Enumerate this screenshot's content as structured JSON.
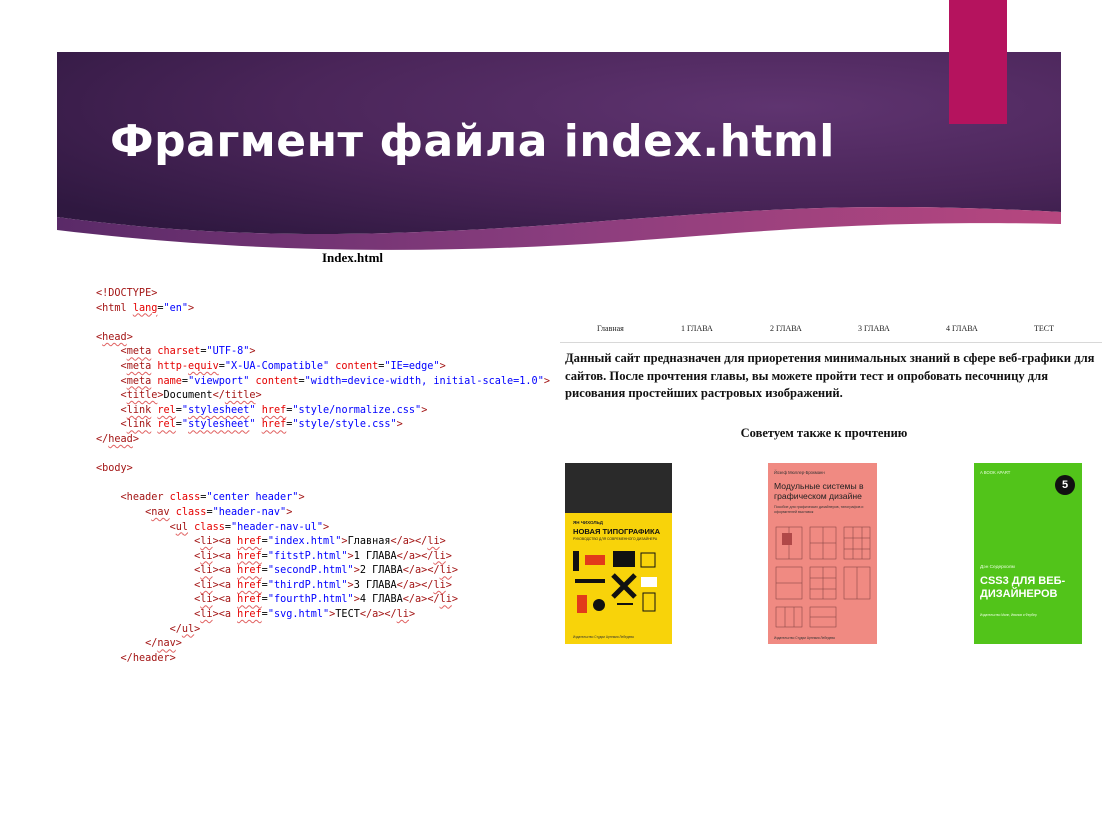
{
  "slide": {
    "title": "Фрагмент файла index.html",
    "code_heading": "Index.html",
    "colors": {
      "banner": "#4b2458",
      "accent": "#b5135e"
    }
  },
  "code_lines": [
    [
      "<!DOCTYPE html>"
    ],
    [
      "<html lang=\"en\">"
    ],
    [
      ""
    ],
    [
      "<head>"
    ],
    [
      "    <meta charset=\"UTF-8\">"
    ],
    [
      "    <meta http-equiv=\"X-UA-Compatible\" content=\"IE=edge\">"
    ],
    [
      "    <meta name=\"viewport\" content=\"width=device-width, initial-scale=1.0\">"
    ],
    [
      "    <title>Document</title>"
    ],
    [
      "    <link rel=\"stylesheet\" href=\"style/normalize.css\">"
    ],
    [
      "    <link rel=\"stylesheet\" href=\"style/style.css\">"
    ],
    [
      "</head>"
    ],
    [
      ""
    ],
    [
      "<body>"
    ],
    [
      ""
    ],
    [
      "    <header class=\"center header\">"
    ],
    [
      "        <nav class=\"header-nav\">"
    ],
    [
      "            <ul class=\"header-nav-ul\">"
    ],
    [
      "                <li><a href=\"index.html\">Главная</a></li>"
    ],
    [
      "                <li><a href=\"fitstP.html\">1 ГЛАВА</a></li>"
    ],
    [
      "                <li><a href=\"secondP.html\">2 ГЛАВА</a></li>"
    ],
    [
      "                <li><a href=\"thirdP.html\">3 ГЛАВА</a></li>"
    ],
    [
      "                <li><a href=\"fourthP.html\">4 ГЛАВА</a></li>"
    ],
    [
      "                <li><a href=\"svg.html\">ТЕСТ</a></li>"
    ],
    [
      "            </ul>"
    ],
    [
      "        </nav>"
    ],
    [
      "    </header>"
    ]
  ],
  "site": {
    "nav": [
      "Главная",
      "1 ГЛАВА",
      "2 ГЛАВА",
      "3 ГЛАВА",
      "4 ГЛАВА",
      "ТЕСТ"
    ],
    "intro": "Данный сайт предназначен для приоретения минимальных знаний в сфере веб-графики для сайтов. После прочтения главы, вы можете пройти тест и опробовать песочницу для рисования простейших растровых изображений.",
    "recommend": "Советуем также к прочтению",
    "books": [
      {
        "author": "ЯН ЧИХОЛЬД",
        "title": "НОВАЯ ТИПОГРАФИКА",
        "subtitle": "РУКОВОДСТВО ДЛЯ СОВРЕМЕННОГО ДИЗАЙНЕРА",
        "publisher": "Издательство Студии Артемия Лебедева",
        "color": "#f8d30a"
      },
      {
        "author": "Йозеф Мюллер-Брокманн",
        "title": "Модульные системы в графическом дизайне",
        "subtitle": "Пособие для графических дизайнеров, типографов и оформителей выставок",
        "publisher": "Издательство Студии Артемия Лебедева",
        "color": "#f08a82"
      },
      {
        "series": "A BOOK APART",
        "badge": "5",
        "author": "Дэн Седерхолм",
        "title": "CSS3 ДЛЯ ВЕБ-ДИЗАЙНЕРОВ",
        "publisher": "Издательство Манн, Иванов и Фербер",
        "color": "#52c41a"
      }
    ]
  }
}
